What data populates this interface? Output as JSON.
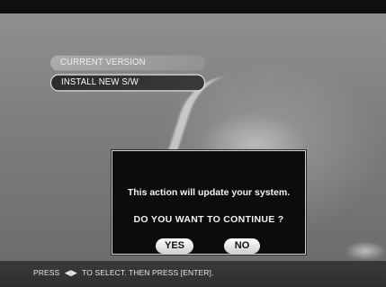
{
  "menu": {
    "items": [
      {
        "label": "CURRENT VERSION"
      },
      {
        "label": "INSTALL NEW S/W"
      }
    ]
  },
  "dialog": {
    "message": "This action will update your system.",
    "question": "DO YOU WANT TO CONTINUE ?",
    "yes_label": "YES",
    "no_label": "NO"
  },
  "footer": {
    "press": "PRESS",
    "arrows_icon": "left-right-arrows-icon",
    "instruction": "TO SELECT. THEN PRESS [ENTER]."
  },
  "colors": {
    "dialog_bg": "#0c0c0c",
    "selected_border": "#f2f2f2"
  }
}
